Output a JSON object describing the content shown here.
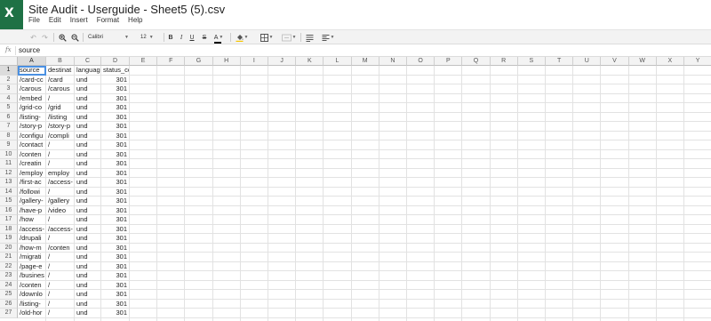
{
  "app": {
    "logo_letter": "X",
    "title": "Site Audit - Userguide - Sheet5 (5).csv"
  },
  "menu": [
    "File",
    "Edit",
    "Insert",
    "Format",
    "Help"
  ],
  "toolbar": {
    "undo_icon": "undo-icon",
    "redo_icon": "redo-icon",
    "zoom_in_icon": "zoom-in-icon",
    "zoom_out_icon": "zoom-out-icon",
    "font_family": "Calibri",
    "font_size": "12",
    "bold": "B",
    "italic": "I",
    "underline": "U",
    "strike": "S",
    "text_color": "A"
  },
  "formula_bar": {
    "label": "fx",
    "value": "source"
  },
  "columns": [
    "A",
    "B",
    "C",
    "D",
    "E",
    "F",
    "G",
    "H",
    "I",
    "J",
    "K",
    "L",
    "M",
    "N",
    "O",
    "P",
    "Q",
    "R",
    "S",
    "T",
    "U",
    "V",
    "W",
    "X",
    "Y"
  ],
  "row_numbers": [
    "1",
    "2",
    "3",
    "4",
    "5",
    "6",
    "7",
    "8",
    "9",
    "10",
    "11",
    "12",
    "13",
    "14",
    "15",
    "16",
    "17",
    "18",
    "19",
    "20",
    "21",
    "22",
    "23",
    "24",
    "25",
    "26",
    "27"
  ],
  "headers": [
    "source",
    "destinat",
    "languag",
    "status_code"
  ],
  "rows": [
    [
      "/card-cc",
      "/card",
      "und",
      "301"
    ],
    [
      "/carous",
      "/carous",
      "und",
      "301"
    ],
    [
      "/embed",
      "/",
      "und",
      "301"
    ],
    [
      "/grid-co",
      "/grid",
      "und",
      "301"
    ],
    [
      "/listing-",
      "/listing",
      "und",
      "301"
    ],
    [
      "/story-p",
      "/story-p",
      "und",
      "301"
    ],
    [
      "/configu",
      "/compli",
      "und",
      "301"
    ],
    [
      "/contact",
      "/",
      "und",
      "301"
    ],
    [
      "/conten",
      "/",
      "und",
      "301"
    ],
    [
      "/creatin",
      "/",
      "und",
      "301"
    ],
    [
      "/employ",
      "employ",
      "und",
      "301"
    ],
    [
      "/first-ac",
      "/access-",
      "und",
      "301"
    ],
    [
      "/followi",
      "/",
      "und",
      "301"
    ],
    [
      "/gallery-",
      "/gallery",
      "und",
      "301"
    ],
    [
      "/have-p",
      "/video",
      "und",
      "301"
    ],
    [
      "/how",
      "/",
      "und",
      "301"
    ],
    [
      "/access-",
      "/access-",
      "und",
      "301"
    ],
    [
      "/drupali",
      "/",
      "und",
      "301"
    ],
    [
      "/how-m",
      "/conten",
      "und",
      "301"
    ],
    [
      "/migrati",
      "/",
      "und",
      "301"
    ],
    [
      "/page-e",
      "/",
      "und",
      "301"
    ],
    [
      "/busines",
      "/",
      "und",
      "301"
    ],
    [
      "/conten",
      "/",
      "und",
      "301"
    ],
    [
      "/downlo",
      "/",
      "und",
      "301"
    ],
    [
      "/listing-",
      "/",
      "und",
      "301"
    ],
    [
      "/old-hor",
      "/",
      "und",
      "301"
    ]
  ],
  "colors": {
    "brand_green": "#1e7145",
    "selection": "#4a90e2"
  }
}
